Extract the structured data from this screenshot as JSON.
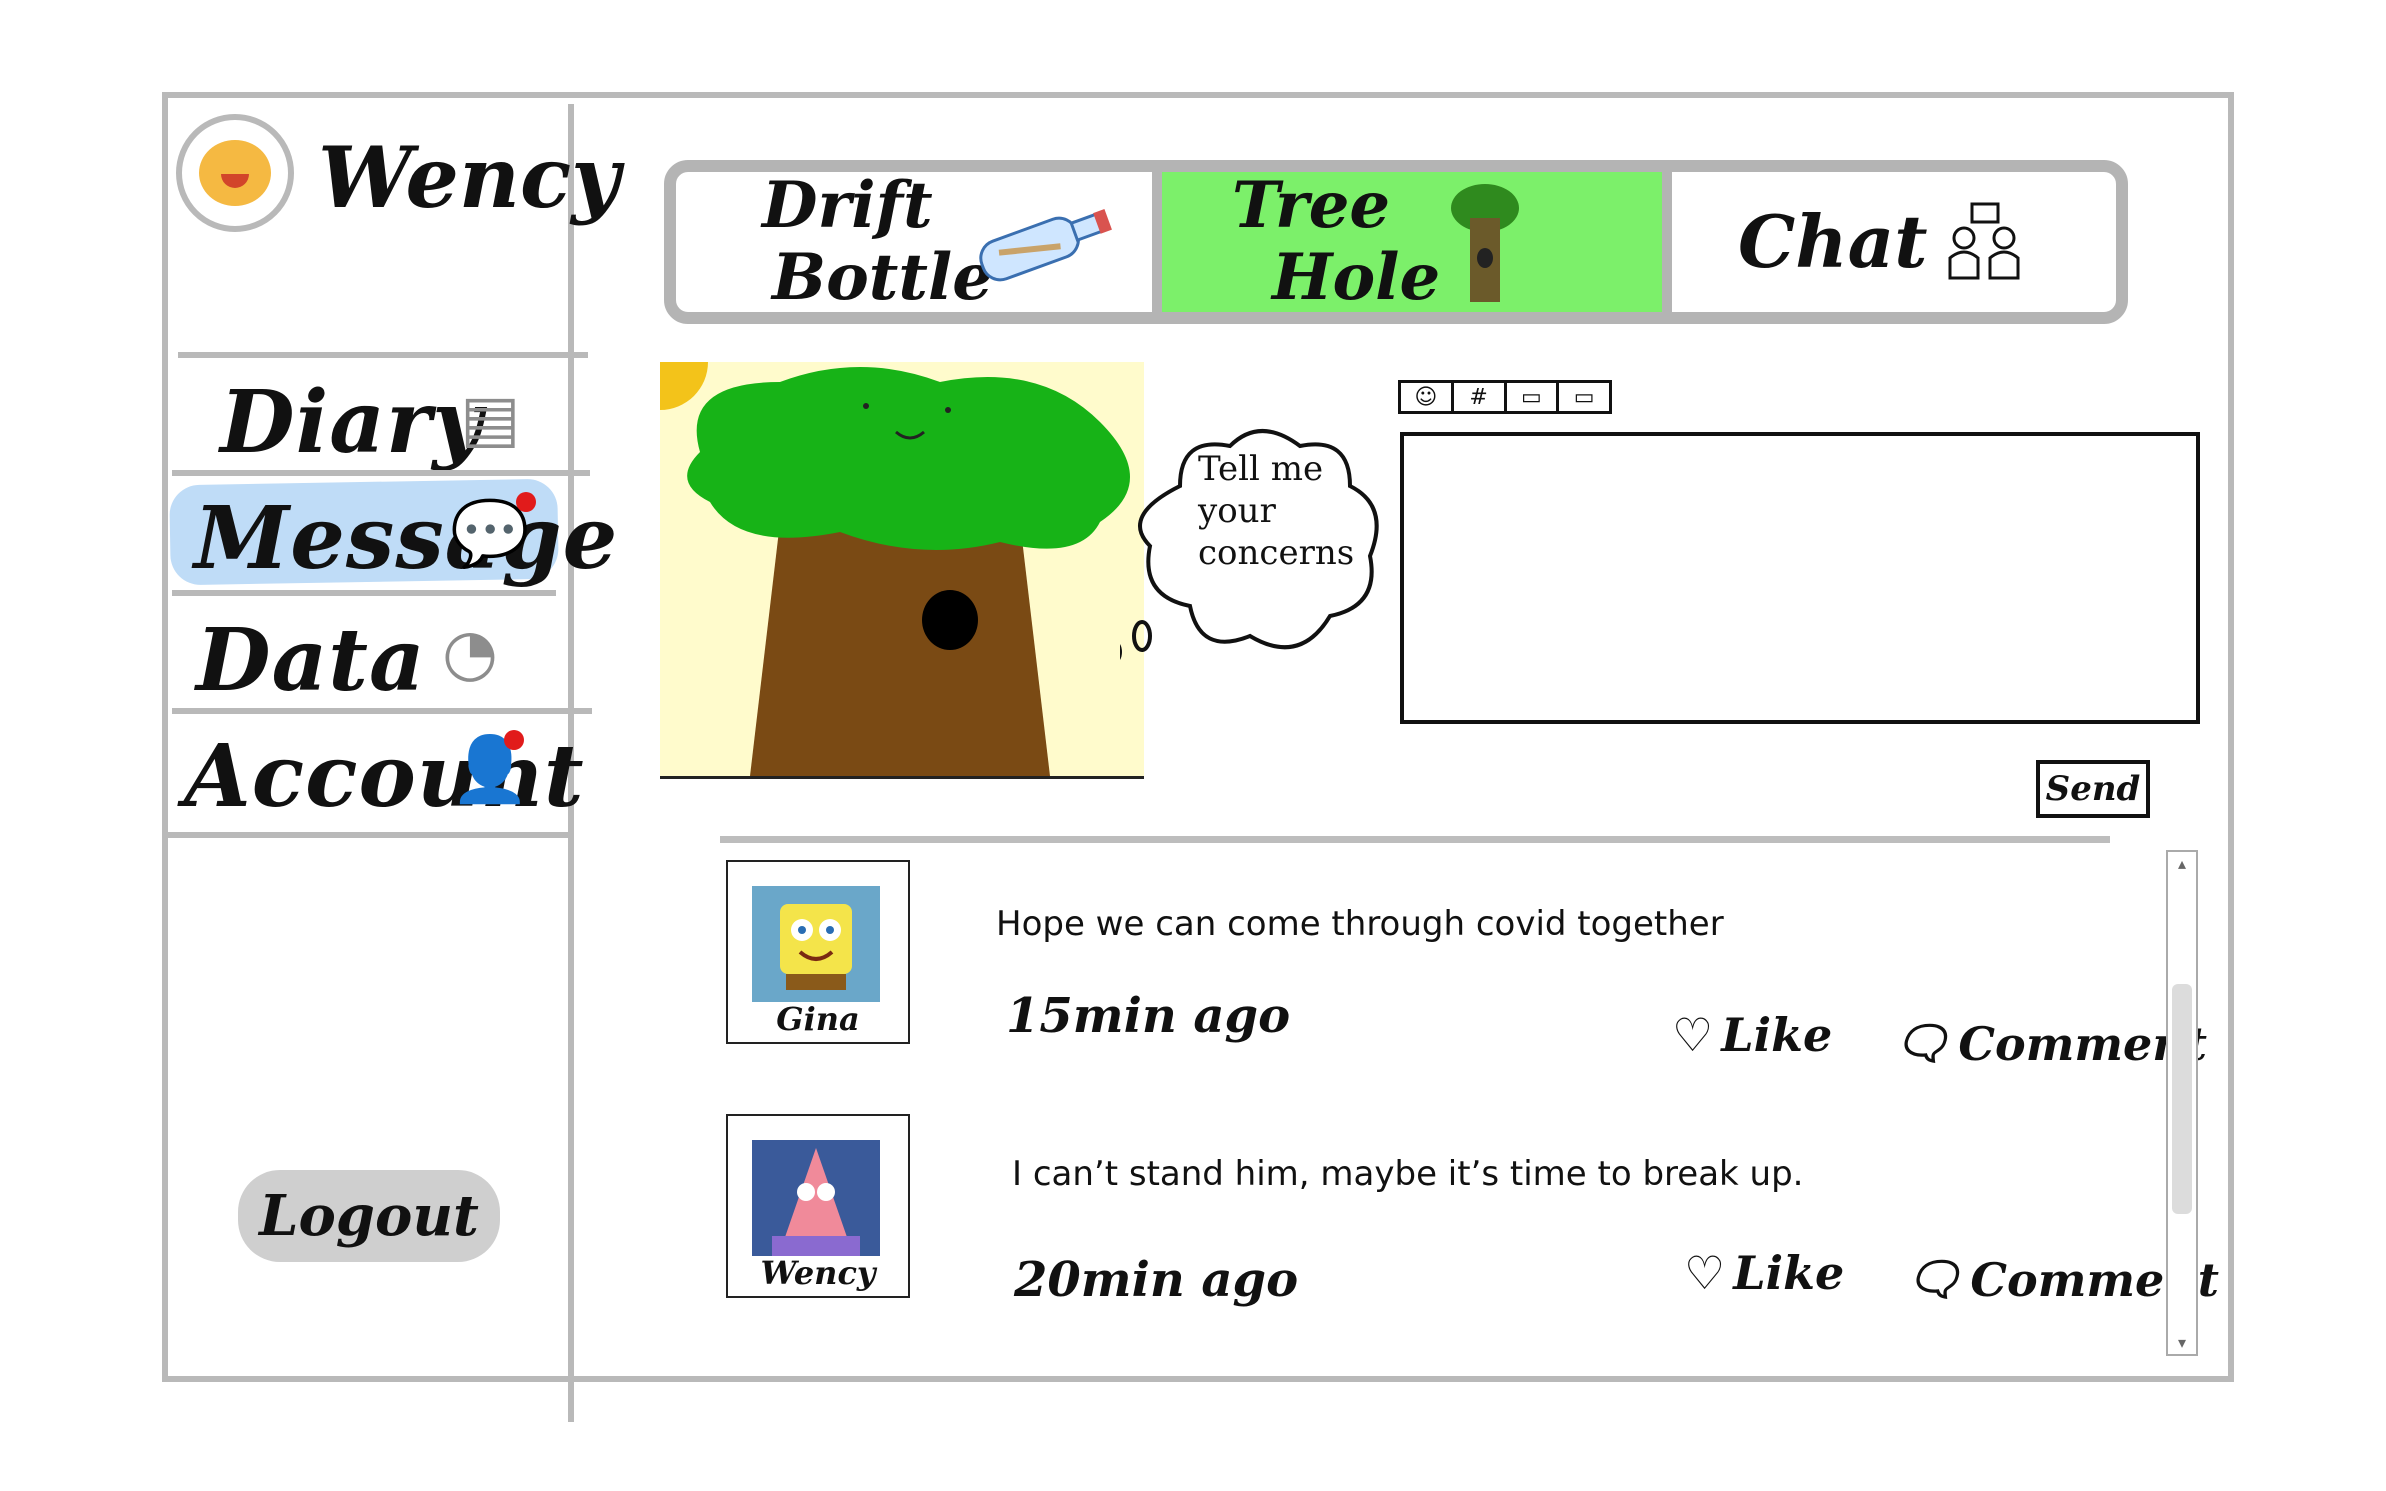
{
  "user": {
    "name": "Wency"
  },
  "sidebar": {
    "items": [
      {
        "label": "Diary",
        "icon": "notebook-icon"
      },
      {
        "label": "Message",
        "icon": "chat-bubble-icon",
        "badge": true,
        "active": true
      },
      {
        "label": "Data",
        "icon": "pie-chart-icon"
      },
      {
        "label": "Account",
        "icon": "person-icon",
        "badge": true
      }
    ],
    "logout_label": "Logout"
  },
  "tabs": [
    {
      "label_line1": "Drift",
      "label_line2": "Bottle",
      "icon": "bottle-icon"
    },
    {
      "label_line1": "Tree",
      "label_line2": "Hole",
      "icon": "tree-icon",
      "active": true,
      "color": "#7cf06a"
    },
    {
      "label_line1": "Chat",
      "label_line2": "",
      "icon": "group-icon"
    }
  ],
  "tree_hole": {
    "speech": "Tell me your concerns"
  },
  "composer": {
    "tools": [
      "emoji-icon",
      "hashtag-icon",
      "image-icon",
      "video-icon"
    ],
    "tool_glyphs": [
      "☺",
      "#",
      "▭",
      "▭"
    ],
    "send_label": "Send",
    "value": ""
  },
  "posts": [
    {
      "author": "Gina",
      "text": "Hope we can come through covid together",
      "time": "15min ago",
      "like_label": "Like",
      "comment_label": "Comment"
    },
    {
      "author": "Wency",
      "text": "I can’t stand him, maybe it’s time to break up.",
      "time": "20min ago",
      "like_label": "Like",
      "comment_label": "Comment"
    }
  ],
  "colors": {
    "frame": "#b9b9b9",
    "active_tab": "#7cf06a",
    "active_nav": "#bfdcf7",
    "badge": "#e11b1b"
  }
}
